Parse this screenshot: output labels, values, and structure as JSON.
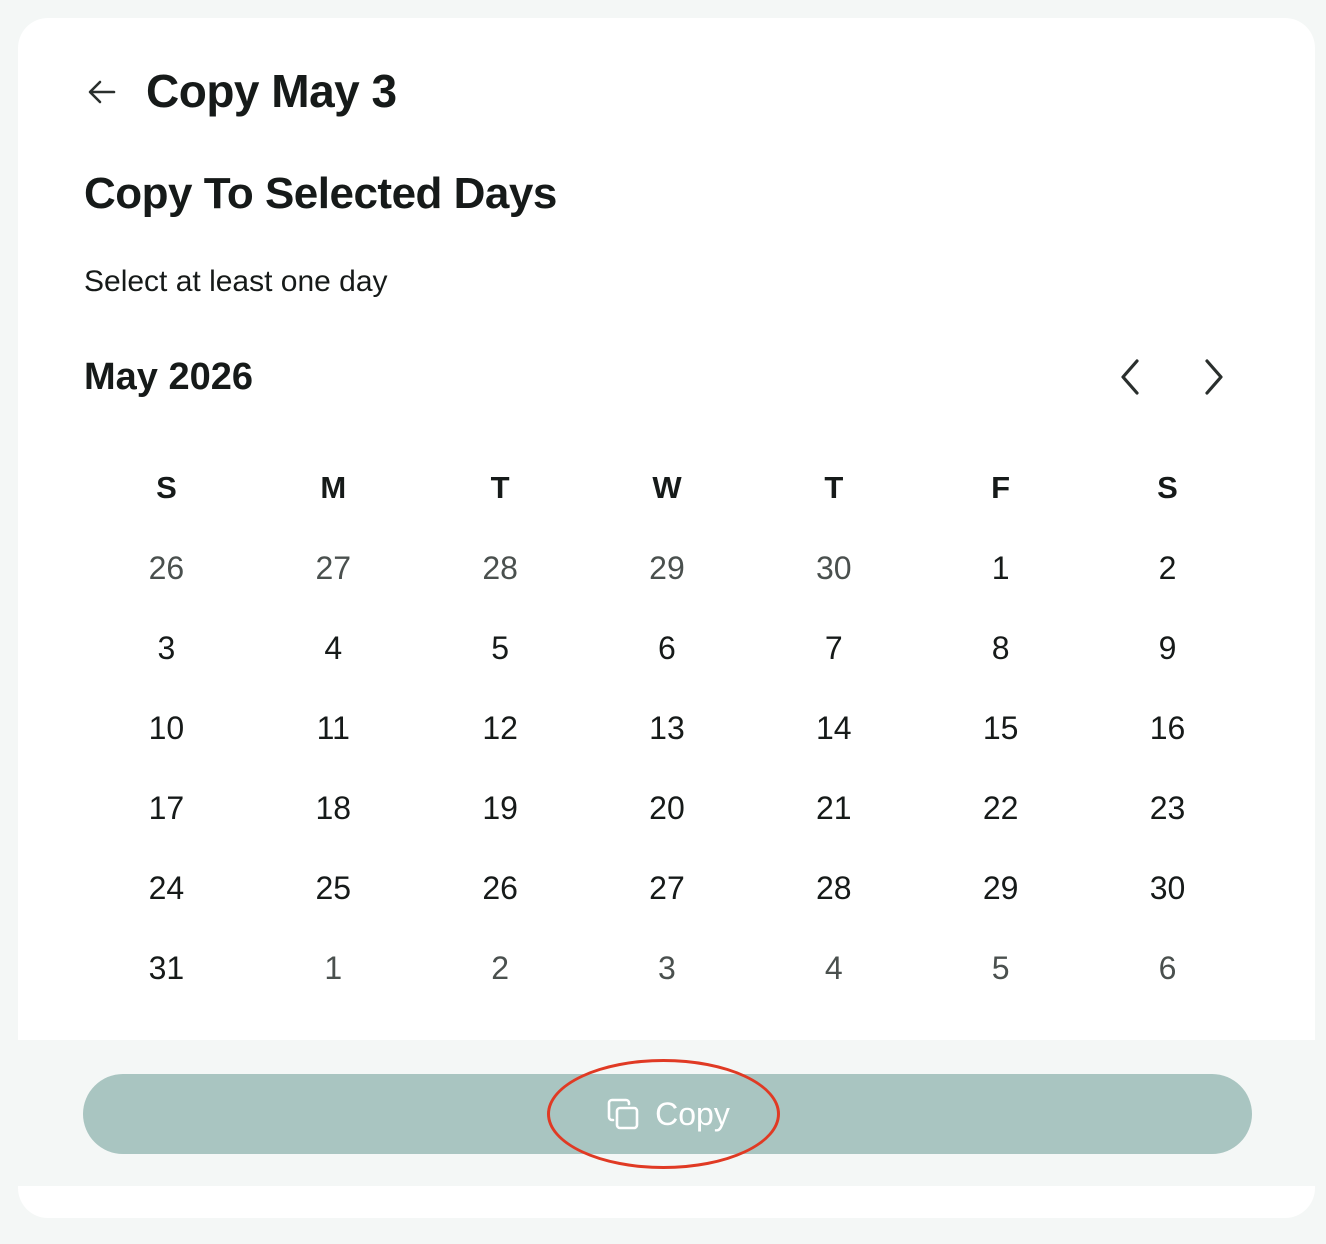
{
  "header": {
    "title": "Copy May 3",
    "back_icon": "arrow-left-icon"
  },
  "section": {
    "title": "Copy To Selected Days",
    "helper": "Select at least one day"
  },
  "calendar": {
    "month_label": "May 2026",
    "prev_icon": "chevron-left-icon",
    "next_icon": "chevron-right-icon",
    "weekdays": [
      "S",
      "M",
      "T",
      "W",
      "T",
      "F",
      "S"
    ],
    "weeks": [
      [
        {
          "label": "26",
          "in_month": false
        },
        {
          "label": "27",
          "in_month": false
        },
        {
          "label": "28",
          "in_month": false
        },
        {
          "label": "29",
          "in_month": false
        },
        {
          "label": "30",
          "in_month": false
        },
        {
          "label": "1",
          "in_month": true
        },
        {
          "label": "2",
          "in_month": true
        }
      ],
      [
        {
          "label": "3",
          "in_month": true
        },
        {
          "label": "4",
          "in_month": true
        },
        {
          "label": "5",
          "in_month": true
        },
        {
          "label": "6",
          "in_month": true
        },
        {
          "label": "7",
          "in_month": true
        },
        {
          "label": "8",
          "in_month": true
        },
        {
          "label": "9",
          "in_month": true
        }
      ],
      [
        {
          "label": "10",
          "in_month": true
        },
        {
          "label": "11",
          "in_month": true
        },
        {
          "label": "12",
          "in_month": true
        },
        {
          "label": "13",
          "in_month": true
        },
        {
          "label": "14",
          "in_month": true
        },
        {
          "label": "15",
          "in_month": true
        },
        {
          "label": "16",
          "in_month": true
        }
      ],
      [
        {
          "label": "17",
          "in_month": true
        },
        {
          "label": "18",
          "in_month": true
        },
        {
          "label": "19",
          "in_month": true
        },
        {
          "label": "20",
          "in_month": true
        },
        {
          "label": "21",
          "in_month": true
        },
        {
          "label": "22",
          "in_month": true
        },
        {
          "label": "23",
          "in_month": true
        }
      ],
      [
        {
          "label": "24",
          "in_month": true
        },
        {
          "label": "25",
          "in_month": true
        },
        {
          "label": "26",
          "in_month": true
        },
        {
          "label": "27",
          "in_month": true
        },
        {
          "label": "28",
          "in_month": true
        },
        {
          "label": "29",
          "in_month": true
        },
        {
          "label": "30",
          "in_month": true
        }
      ],
      [
        {
          "label": "31",
          "in_month": true
        },
        {
          "label": "1",
          "in_month": false
        },
        {
          "label": "2",
          "in_month": false
        },
        {
          "label": "3",
          "in_month": false
        },
        {
          "label": "4",
          "in_month": false
        },
        {
          "label": "5",
          "in_month": false
        },
        {
          "label": "6",
          "in_month": false
        }
      ]
    ]
  },
  "footer": {
    "copy_label": "Copy",
    "copy_icon": "copy-icon",
    "button_color": "#a9c5c1",
    "highlight_color": "#e03a24"
  }
}
